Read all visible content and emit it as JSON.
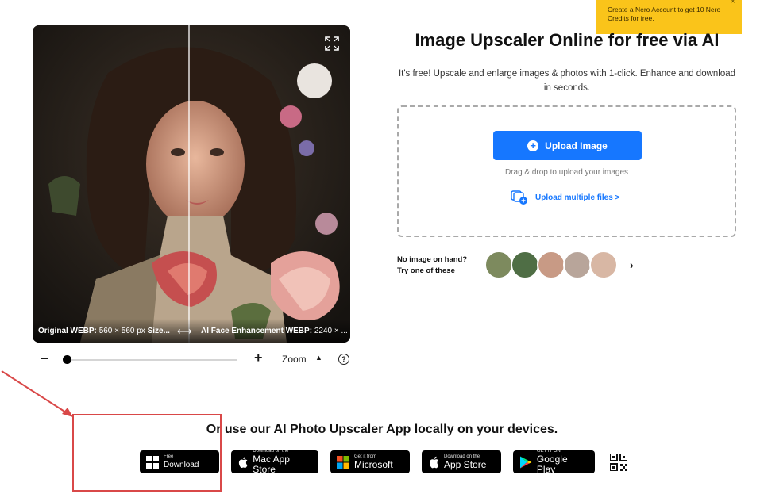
{
  "toast": {
    "text": "Create a Nero Account to get 10 Nero Credits for free.",
    "close_icon": "×"
  },
  "preview": {
    "original_label": "Original WEBP:",
    "original_size": "560 × 560 px",
    "size_label": "Size...",
    "compare_icon": "⟷",
    "enhanced_label": "AI Face Enhancement WEBP:",
    "enhanced_size": "2240 × ..."
  },
  "zoom": {
    "minus": "−",
    "plus": "+",
    "label": "Zoom",
    "caret": "▲",
    "help": "?",
    "level": 0.0
  },
  "main": {
    "title": "Image Upscaler Online for free via AI",
    "subtitle": "It's free! Upscale and enlarge images & photos with 1-click. Enhance and download in seconds.",
    "upload_button": "Upload Image",
    "drag_text": "Drag & drop to upload your images",
    "multi_link": "Upload multiple files >"
  },
  "samples": {
    "line1": "No image on hand?",
    "line2": "Try one of these",
    "next": "›",
    "thumb_colors": [
      "#7d8a5e",
      "#4f6e45",
      "#c89a85",
      "#b8a59a",
      "#d8b7a4"
    ]
  },
  "apps": {
    "title": "Or use our AI Photo Upscaler App locally on your devices.",
    "badges": [
      {
        "small": "Free",
        "big": "Download",
        "icon": "windows-icon"
      },
      {
        "small": "Download on the",
        "big": "Mac App Store",
        "icon": "apple-icon"
      },
      {
        "small": "Get it from",
        "big": "Microsoft",
        "icon": "microsoft-icon"
      },
      {
        "small": "Download on the",
        "big": "App Store",
        "icon": "apple-icon"
      },
      {
        "small": "GET IT ON",
        "big": "Google Play",
        "icon": "google-play-icon"
      }
    ]
  },
  "colors": {
    "accent": "#1677ff",
    "toast": "#fac41a",
    "annotation": "#d94848"
  }
}
